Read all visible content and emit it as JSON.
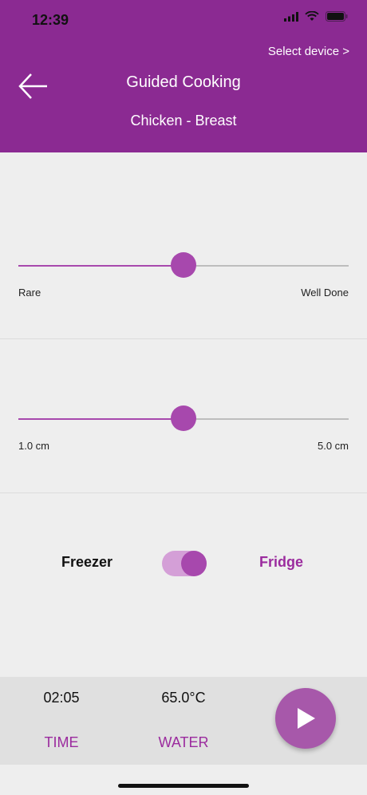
{
  "status_bar": {
    "time": "12:39"
  },
  "header": {
    "select_device": "Select device >",
    "title": "Guided Cooking",
    "subtitle": "Chicken - Breast"
  },
  "doneness_slider": {
    "min_label": "Rare",
    "max_label": "Well Done",
    "value": 0.5
  },
  "thickness_slider": {
    "min_label": "1.0 cm",
    "max_label": "5.0 cm",
    "value": 0.5
  },
  "storage_toggle": {
    "left_label": "Freezer",
    "right_label": "Fridge",
    "selected": "Fridge"
  },
  "bottom_bar": {
    "time_value": "02:05",
    "time_label": "TIME",
    "water_value": "65.0°C",
    "water_label": "WATER"
  },
  "colors": {
    "primary": "#8b2a92",
    "accent": "#a748ad"
  }
}
